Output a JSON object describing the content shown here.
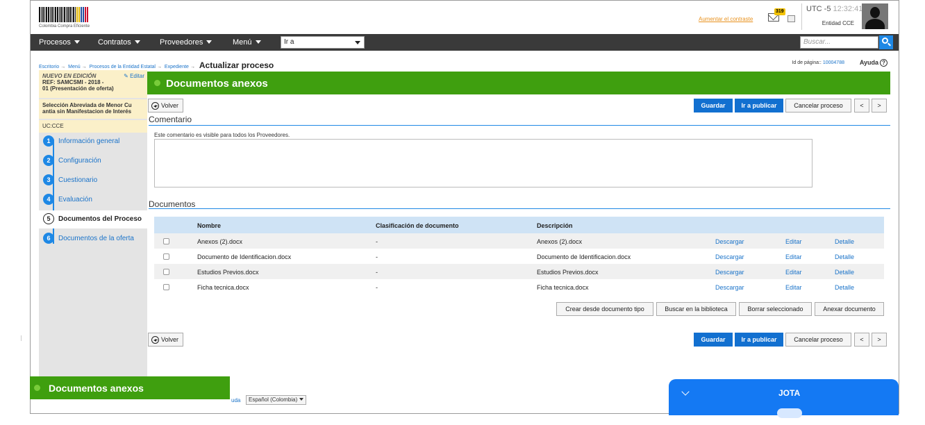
{
  "header": {
    "logo_text": "Colombia Compra Eficiente",
    "contrast_link": "Aumentar el contraste",
    "mail_count": "319",
    "timezone": "UTC -5",
    "time": "12:32:41",
    "entity": "Entidad CCE"
  },
  "nav": {
    "items": [
      "Procesos",
      "Contratos",
      "Proveedores",
      "Menú"
    ],
    "goto_value": "Ir a",
    "search_placeholder": "Buscar..."
  },
  "breadcrumb": {
    "items": [
      "Escritorio",
      "Menú",
      "Procesos de la Entidad Estatal",
      "Expediente"
    ],
    "current": "Actualizar proceso",
    "page_id_label": "Id de página::",
    "page_id_value": "10004788",
    "help": "Ayuda"
  },
  "sidebar": {
    "status": "NUEVO EN EDICIÓN",
    "edit_label": "Editar",
    "ref_line1": "REF: SAMCSMI - 2018 -",
    "ref_line2": "01 (Presentación de oferta)",
    "modality_line1": "Selección Abreviada de Menor Cu",
    "modality_line2": "antia sin Manifestacion de Interés",
    "uc": "UC:CCE",
    "steps": [
      {
        "num": "1",
        "label": "Información general"
      },
      {
        "num": "2",
        "label": "Configuración"
      },
      {
        "num": "3",
        "label": "Cuestionario"
      },
      {
        "num": "4",
        "label": "Evaluación"
      },
      {
        "num": "5",
        "label": "Documentos del Proceso"
      },
      {
        "num": "6",
        "label": "Documentos de la oferta"
      }
    ]
  },
  "section": {
    "title": "Documentos anexos"
  },
  "toolbar": {
    "back": "Volver",
    "save": "Guardar",
    "publish": "Ir a publicar",
    "cancel": "Cancelar proceso",
    "prev": "<",
    "next": ">"
  },
  "comment": {
    "title": "Comentario",
    "note": "Este comentario es visible para todos los Proveedores.",
    "value": ""
  },
  "documents": {
    "title": "Documentos",
    "columns": [
      "Nombre",
      "Clasificación de documento",
      "Descripción"
    ],
    "rows": [
      {
        "name": "Anexos (2).docx",
        "classification": "-",
        "description": "Anexos (2).docx"
      },
      {
        "name": "Documento de Identificacion.docx",
        "classification": "-",
        "description": "Documento de Identificacion.docx"
      },
      {
        "name": "Estudios Previos.docx",
        "classification": "-",
        "description": "Estudios Previos.docx"
      },
      {
        "name": "Ficha tecnica.docx",
        "classification": "-",
        "description": "Ficha tecnica.docx"
      }
    ],
    "row_actions": {
      "download": "Descargar",
      "edit": "Editar",
      "detail": "Detalle"
    },
    "buttons": {
      "from_template": "Crear desde documento tipo",
      "library": "Buscar en la biblioteca",
      "delete_selected": "Borrar seleccionado",
      "attach": "Anexar documento"
    }
  },
  "chat": {
    "name": "JOTA"
  },
  "footer": {
    "help_fragment": "uda",
    "language": "Español (Colombia)"
  },
  "colors": {
    "green_header": "#3f9f0f",
    "primary_blue": "#1270d0",
    "nav_dark": "#3a3a3a",
    "chat_blue": "#1479f3"
  }
}
